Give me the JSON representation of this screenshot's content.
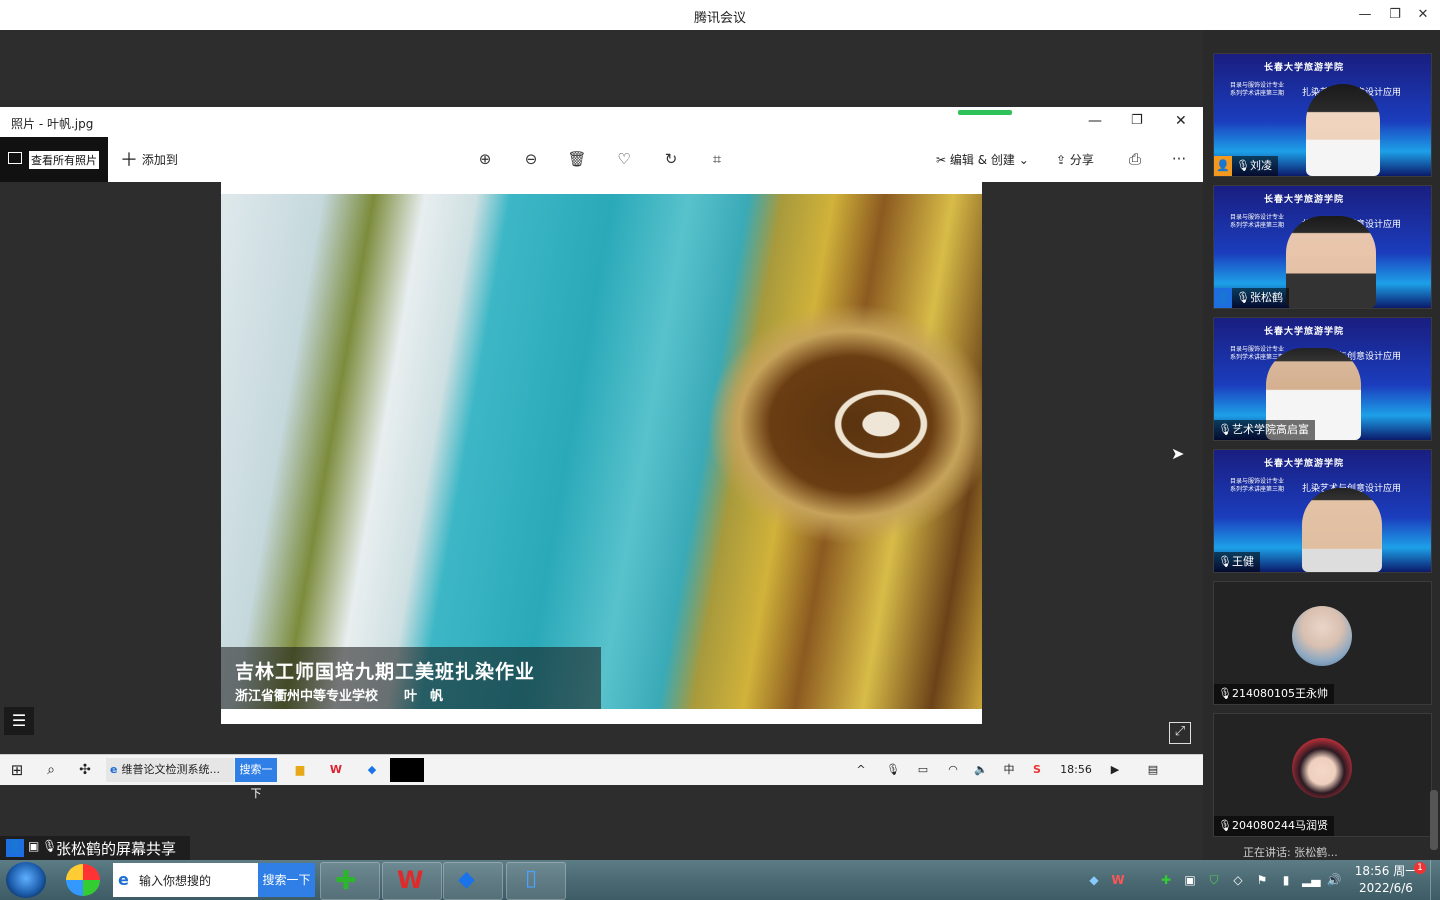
{
  "window": {
    "title": "腾讯会议"
  },
  "photos": {
    "title": "照片 - 叶帆.jpg",
    "view_all": "查看所有照片",
    "add_to": "添加到",
    "edit_create": "编辑 & 创建",
    "share": "分享",
    "more": "···"
  },
  "photo_caption": {
    "line1": "吉林工师国培九期工美班扎染作业",
    "line2": "浙江省衢州中等专业学校　　叶　帆"
  },
  "inner_taskbar": {
    "browser_tab": "维普论文检测系统...",
    "search_btn": "搜索一下",
    "time": "18:56"
  },
  "share_label": "张松鹤的屏幕共享",
  "banner": {
    "college": "长春大学旅游学院",
    "series": "目录与服饰设计专业\n系列学术讲座第三期",
    "topic": "扎染艺术与创意设计应用"
  },
  "participants": [
    {
      "name": "刘凌",
      "type": "video"
    },
    {
      "name": "张松鹤",
      "type": "video"
    },
    {
      "name": "艺术学院高启富",
      "type": "video"
    },
    {
      "name": "王健",
      "type": "video"
    },
    {
      "name": "214080105王永帅",
      "type": "avatar"
    },
    {
      "name": "204080244马润贤",
      "type": "avatar"
    }
  ],
  "speaking": "正在讲话: 张松鹤...",
  "taskbar": {
    "search_placeholder": "输入你想搜的",
    "search_btn": "搜索一下",
    "time": "18:56 周一",
    "date": "2022/6/6",
    "notif_count": "1"
  }
}
